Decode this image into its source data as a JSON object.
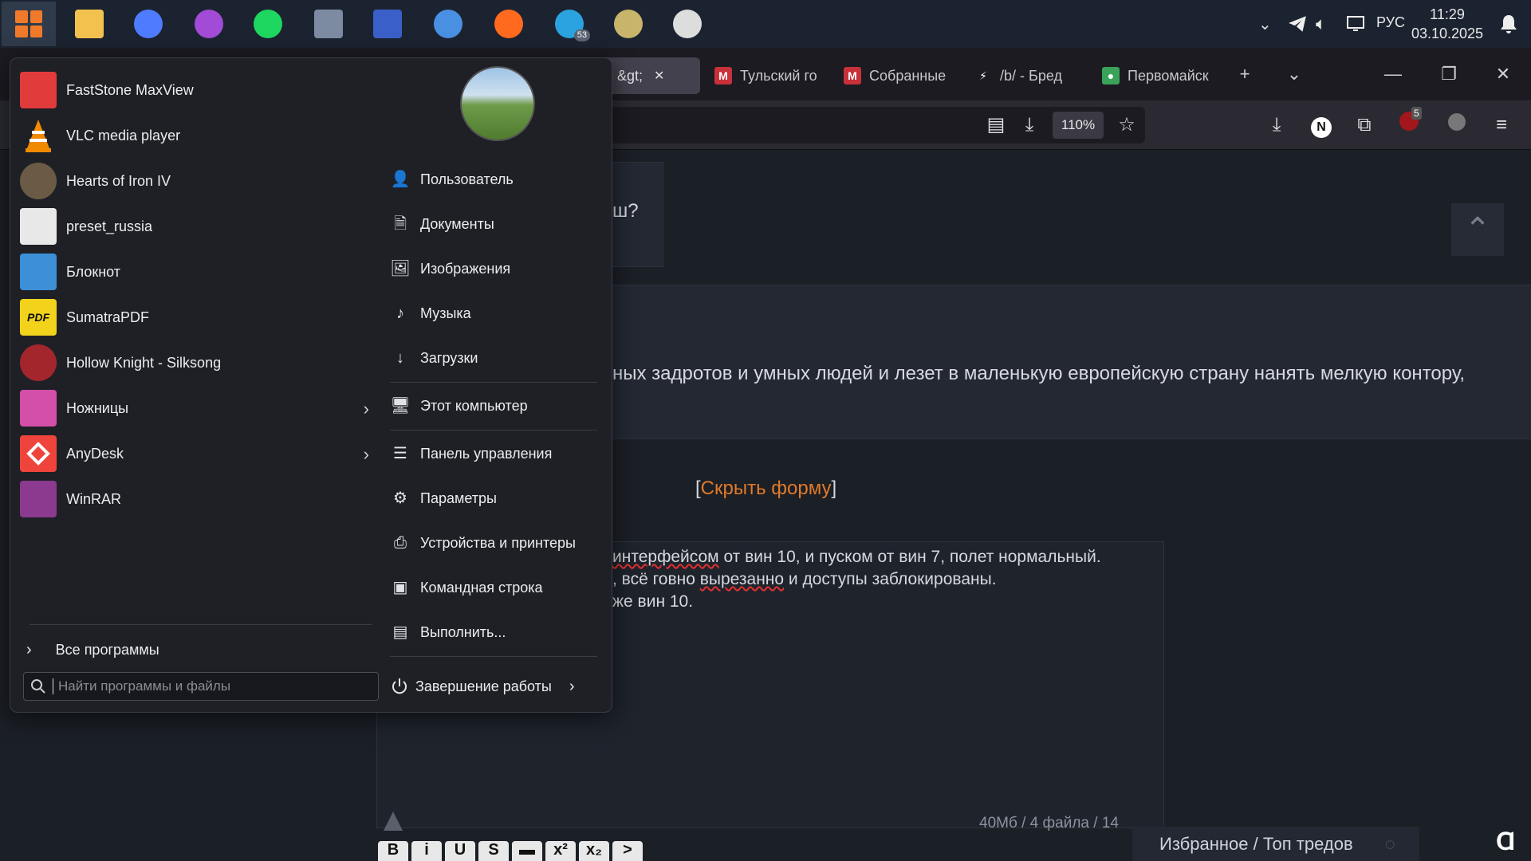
{
  "taskbar": {
    "apps": [
      {
        "name": "file-explorer",
        "color": "#f2c14e"
      },
      {
        "name": "chromium",
        "color": "#4f7cff"
      },
      {
        "name": "proxy-mask",
        "color": "#a24bd6"
      },
      {
        "name": "spotify",
        "color": "#1ed760"
      },
      {
        "name": "calculator",
        "color": "#7c8ba1"
      },
      {
        "name": "save-disk",
        "color": "#3a5fc8"
      },
      {
        "name": "qbittorrent",
        "color": "#4a90e2"
      },
      {
        "name": "firefox",
        "color": "#ff6a1f"
      },
      {
        "name": "telegram",
        "color": "#2aa3e0"
      },
      {
        "name": "security-tool",
        "color": "#c9b46b"
      },
      {
        "name": "speedometer",
        "color": "#dddddd"
      }
    ],
    "telegram_badge": "53",
    "lang": "РУС",
    "time": "11:29",
    "date": "03.10.2025"
  },
  "browser": {
    "tabs": [
      {
        "title": "/b/ - &gt;",
        "active": true,
        "fav": "",
        "fav_color": "#42414d"
      },
      {
        "title": "Тульский го",
        "active": false,
        "fav": "M",
        "fav_color": "#c8313a"
      },
      {
        "title": "Собранные",
        "active": false,
        "fav": "M",
        "fav_color": "#c8313a"
      },
      {
        "title": "/b/ - Бред",
        "active": false,
        "fav": "⚡",
        "fav_color": "#1c1b22"
      },
      {
        "title": "Первомайск",
        "active": false,
        "fav": "●",
        "fav_color": "#3aa35a"
      }
    ],
    "zoom": "110%",
    "ext_badge": "5",
    "account_initial": "N"
  },
  "page": {
    "post1_text": "ш?",
    "post2_text": "ных задротов и умных людей и лезет в маленькую европейскую страну нанять мелкую контору,",
    "hide_form_bracket_open": "[",
    "hide_form_link": "Скрыть форму",
    "hide_form_bracket_close": "]",
    "editor_line1_a": "",
    "editor_line1_sp": "интерфейсом",
    "editor_line1_b": " от вин 10, и пуском от вин 7, полет нормальный.",
    "editor_line2_a": ", всё говно ",
    "editor_line2_sp": "вырезанно",
    "editor_line2_b": " и доступы заблокированы.",
    "editor_line3": "же вин 10.",
    "file_info": "40Мб / 4 файла / 14",
    "favorites": "Избранное / Топ тредов",
    "format_buttons": [
      "B",
      "i",
      "U",
      "S",
      "▬",
      "x²",
      "x₂",
      ">"
    ]
  },
  "startmenu": {
    "programs": [
      {
        "label": "FastStone MaxView",
        "icon": "faststone-icon",
        "color": "#e23b3b",
        "submenu": false
      },
      {
        "label": "VLC media player",
        "icon": "vlc-cone-icon",
        "color": "#f08a00",
        "submenu": false
      },
      {
        "label": "Hearts of Iron IV",
        "icon": "hoi4-icon",
        "color": "#6b5a45",
        "submenu": false
      },
      {
        "label": "preset_russia",
        "icon": "settings-file-icon",
        "color": "#e8e8e8",
        "submenu": false
      },
      {
        "label": "Блокнот",
        "icon": "notepad-icon",
        "color": "#3d8fd6",
        "submenu": false
      },
      {
        "label": "SumatraPDF",
        "icon": "pdf-icon",
        "color": "#f2d21b",
        "submenu": false
      },
      {
        "label": "Hollow Knight - Silksong",
        "icon": "silksong-icon",
        "color": "#a3262d",
        "submenu": false
      },
      {
        "label": "Ножницы",
        "icon": "snipping-tool-icon",
        "color": "#d34fa8",
        "submenu": true
      },
      {
        "label": "AnyDesk",
        "icon": "anydesk-icon",
        "color": "#ef443b",
        "submenu": true
      },
      {
        "label": "WinRAR",
        "icon": "winrar-icon",
        "color": "#8b3a8f",
        "submenu": false
      }
    ],
    "all_programs": "Все программы",
    "search_placeholder": "Найти программы и файлы",
    "places": [
      {
        "label": "Пользователь",
        "icon": "user-folder-icon",
        "glyph": "👤"
      },
      {
        "label": "Документы",
        "icon": "document-icon",
        "glyph": "🗎"
      },
      {
        "label": "Изображения",
        "icon": "image-icon",
        "glyph": "🖼"
      },
      {
        "label": "Музыка",
        "icon": "music-note-icon",
        "glyph": "♪"
      },
      {
        "label": "Загрузки",
        "icon": "download-icon",
        "glyph": "↓"
      },
      {
        "label": "Этот компьютер",
        "icon": "computer-icon",
        "glyph": "🖥"
      },
      {
        "label": "Панель управления",
        "icon": "control-panel-icon",
        "glyph": "☰"
      },
      {
        "label": "Параметры",
        "icon": "gear-icon",
        "glyph": "⚙"
      },
      {
        "label": "Устройства и принтеры",
        "icon": "printer-icon",
        "glyph": "⎙"
      },
      {
        "label": "Командная строка",
        "icon": "terminal-icon",
        "glyph": "▣"
      },
      {
        "label": "Выполнить...",
        "icon": "run-icon",
        "glyph": "▤"
      }
    ],
    "shutdown": "Завершение работы"
  }
}
